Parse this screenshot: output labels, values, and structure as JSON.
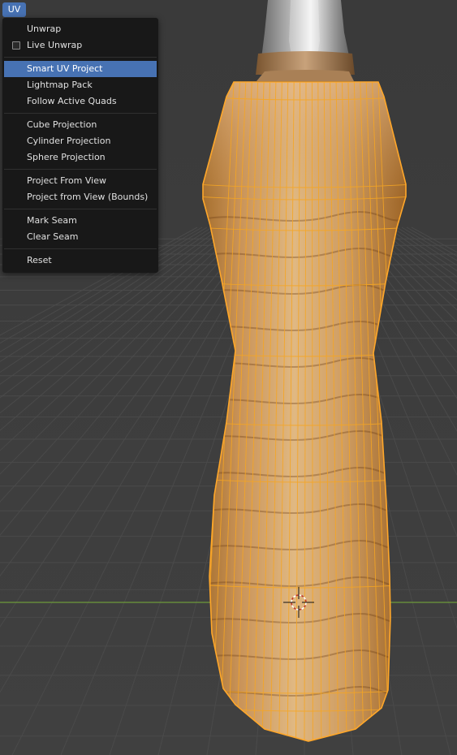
{
  "header": {
    "uv_button_label": "UV"
  },
  "menu": {
    "items": [
      {
        "label": "Unwrap"
      },
      {
        "label": "Live Unwrap",
        "checkbox": true,
        "checked": false
      },
      {
        "label": "Smart UV Project",
        "active": true
      },
      {
        "label": "Lightmap Pack"
      },
      {
        "label": "Follow Active Quads"
      },
      {
        "label": "Cube Projection"
      },
      {
        "label": "Cylinder Projection"
      },
      {
        "label": "Sphere Projection"
      },
      {
        "label": "Project From View"
      },
      {
        "label": "Project from View (Bounds)"
      },
      {
        "label": "Mark Seam"
      },
      {
        "label": "Clear Seam"
      },
      {
        "label": "Reset"
      }
    ]
  },
  "colors": {
    "menu_background": "#181818",
    "highlight": "#4772b3",
    "selection_outline": "#f5a623",
    "x_axis_line": "#6d9a3a",
    "viewport_background": "#3d3d3d"
  },
  "icons": [
    "3d-cursor-icon",
    "checkbox-icon"
  ]
}
